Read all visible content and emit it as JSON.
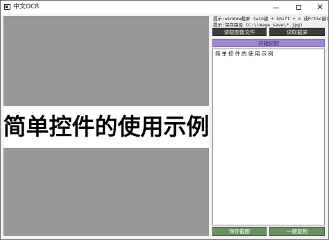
{
  "window": {
    "title": "中文OCR",
    "controls": {
      "close": "✕"
    }
  },
  "image_preview": {
    "text": "简单控件的使用示例"
  },
  "sidebar": {
    "hint_screenshot": "提示:window截屏 (win键 + Shift + s 或PrtSc键)",
    "hint_save_path": "提示:保存路径 (C:\\image_save\\*.jpg)",
    "read_image_label": "读取图像文件",
    "read_screenshot_label": "读取截屏",
    "start_label": "开始识别",
    "result_text": "简单控件的使用示例",
    "save_label": "保存截图",
    "copy_label": "一键复制"
  },
  "colors": {
    "image_panel_bg": "#989898",
    "start_button": "#9b8acb",
    "action_button_green": "#6a8f62",
    "dark_button": "#3c3c3c"
  }
}
